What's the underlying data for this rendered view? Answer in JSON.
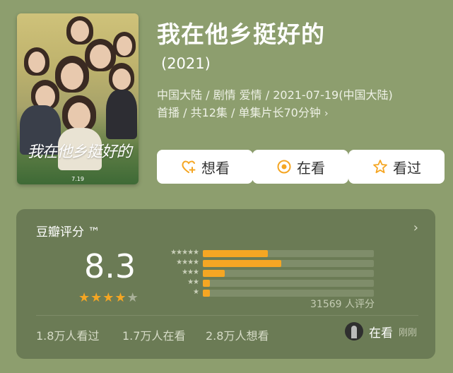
{
  "movie": {
    "title": "我在他乡挺好的",
    "year": "(2021)",
    "meta_line1": "中国大陆 / 剧情 爱情 / 2021-07-19(中国大陆)",
    "meta_line2": "首播 / 共12集 / 单集片长70分钟",
    "poster_title": "我在他乡挺好的",
    "poster_date": "7.19"
  },
  "actions": {
    "want": "想看",
    "watching": "在看",
    "watched": "看过"
  },
  "rating": {
    "header": "豆瓣评分 ™",
    "score": "8.3",
    "stars_filled": 4,
    "stars_total": 5,
    "distribution": [
      {
        "label": "★★★★★",
        "fraction": 0.38
      },
      {
        "label": "★★★★",
        "fraction": 0.46
      },
      {
        "label": "★★★",
        "fraction": 0.13
      },
      {
        "label": "★★",
        "fraction": 0.04
      },
      {
        "label": "★",
        "fraction": 0.04
      }
    ],
    "count": "31569 人评分",
    "watched_count": "1.8万人看过",
    "watching_count": "1.7万人在看",
    "want_count": "2.8万人想看",
    "my_status": "在看",
    "my_time": "刚刚"
  },
  "colors": {
    "background": "#8d9e6e",
    "card": "#6b7b55",
    "accent": "#f5a623"
  }
}
